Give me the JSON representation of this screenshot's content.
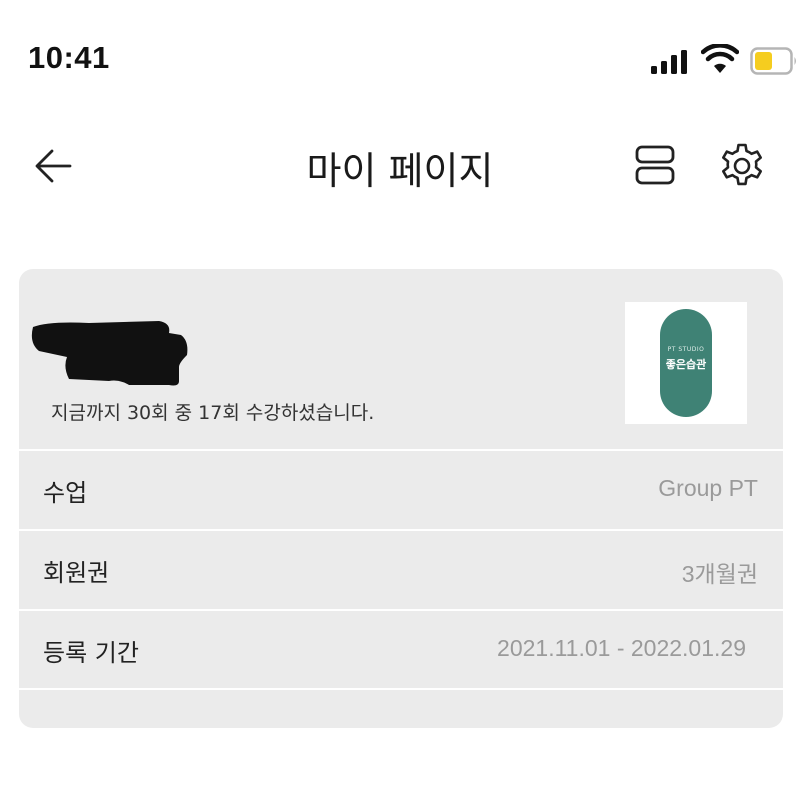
{
  "status_bar": {
    "time": "10:41"
  },
  "nav": {
    "title": "마이 페이지"
  },
  "profile": {
    "summary": "지금까지 30회 중 17회 수강하셨습니다.",
    "logo": {
      "sub_text": "PT STUDIO",
      "main_text": "좋은습관",
      "color": "#3f8275"
    }
  },
  "details": {
    "class_label": "수업",
    "class_value": "Group PT",
    "membership_label": "회원권",
    "membership_value": "3개월권",
    "period_label": "등록 기간",
    "period_value": "2021.11.01 - 2022.01.29"
  }
}
